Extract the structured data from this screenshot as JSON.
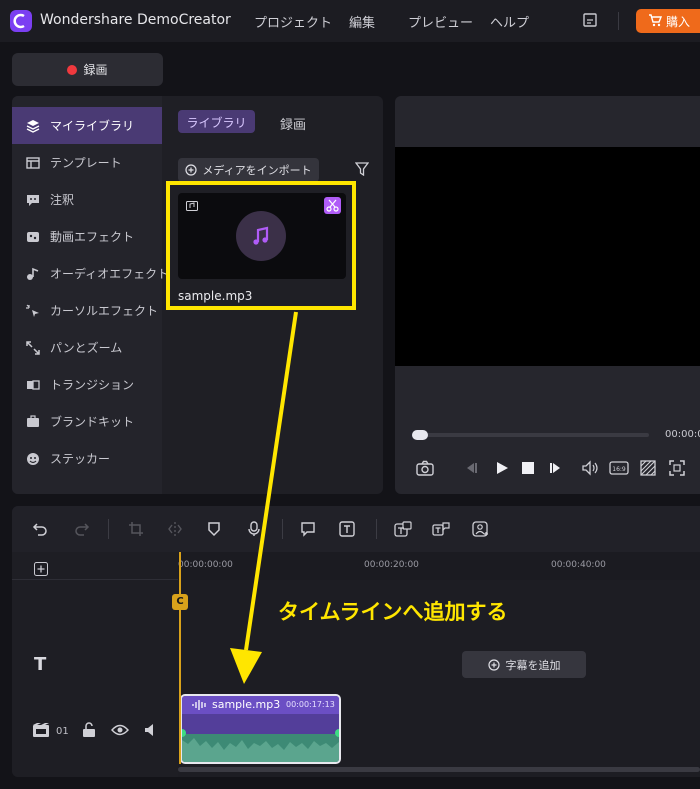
{
  "app": {
    "title": "Wondershare DemoCreator"
  },
  "menu": {
    "items": [
      "プロジェクト",
      "編集",
      "プレビュー",
      "ヘルプ"
    ],
    "buy_label": "購入"
  },
  "record": {
    "label": "録画"
  },
  "library": {
    "sidebar": [
      {
        "label": "マイライブラリ",
        "icon": "library-icon",
        "active": true
      },
      {
        "label": "テンプレート",
        "icon": "template-icon"
      },
      {
        "label": "注釈",
        "icon": "annotation-icon"
      },
      {
        "label": "動画エフェクト",
        "icon": "video-effect-icon"
      },
      {
        "label": "オーディオエフェクト",
        "icon": "audio-effect-icon"
      },
      {
        "label": "カーソルエフェクト",
        "icon": "cursor-effect-icon"
      },
      {
        "label": "パンとズーム",
        "icon": "pan-zoom-icon"
      },
      {
        "label": "トランジション",
        "icon": "transition-icon"
      },
      {
        "label": "ブランドキット",
        "icon": "brand-kit-icon"
      },
      {
        "label": "ステッカー",
        "icon": "sticker-icon"
      }
    ],
    "tabs": {
      "library": "ライブラリ",
      "record": "録画"
    },
    "import_label": "メディアをインポート",
    "media": {
      "name": "sample.mp3"
    }
  },
  "preview": {
    "time": "00:00:0"
  },
  "timeline": {
    "ruler": [
      "00:00:00:00",
      "00:00:20:00",
      "00:00:40:00"
    ],
    "playhead_label": "C",
    "text_track_icon": "T",
    "add_caption_label": "字幕を追加",
    "track_number": "01",
    "clip": {
      "name": "sample.mp3",
      "duration": "00:00:17:13"
    }
  },
  "annotation": {
    "text": "タイムラインへ追加する",
    "color": "#ffe600"
  },
  "colors": {
    "accent": "#7b3ff2",
    "buy": "#ef6a1b",
    "record": "#f0393e",
    "clip": "#6b4fc4",
    "wave": "#3d8a75"
  }
}
